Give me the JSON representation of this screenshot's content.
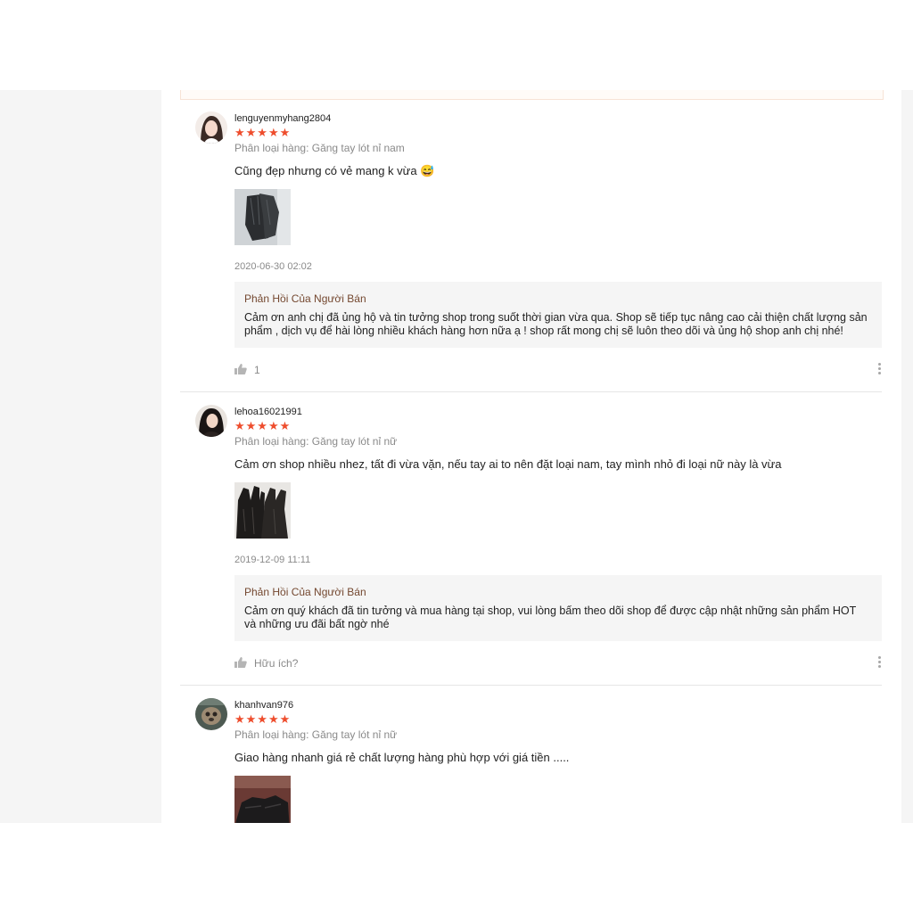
{
  "reviews": [
    {
      "username": "lenguyenmyhang2804",
      "stars": "★★★★★",
      "rating": 5,
      "variant": "Phân loại hàng: Găng tay lót nỉ nam",
      "comment": "Cũng đẹp nhưng có vẻ mang k vừa 😅",
      "date": "2020-06-30 02:02",
      "reply_title": "Phản Hồi Của Người Bán",
      "reply_text": "Cảm ơn anh chị đã ủng hộ và tin tưởng shop trong suốt thời gian vừa qua. Shop sẽ tiếp tục nâng cao cải thiện chất lượng sản phẩm , dịch vụ để hài lòng nhiều khách hàng hơn nữa ạ ! shop  rất mong chị sẽ luôn theo dõi và ủng hộ shop anh chị nhé!",
      "like_label": "1"
    },
    {
      "username": "lehoa16021991",
      "stars": "★★★★★",
      "rating": 5,
      "variant": "Phân loại hàng: Găng tay lót nỉ nữ",
      "comment": "Cảm ơn shop nhiều nhez, tất đi vừa vặn, nếu tay ai to nên đặt loại nam, tay mình nhỏ đi loại nữ này là vừa",
      "date": "2019-12-09 11:11",
      "reply_title": "Phản Hồi Của Người Bán",
      "reply_text": "Cảm ơn quý khách đã tin tưởng và mua hàng tại shop, vui lòng bấm theo dõi shop để được cập nhật những sản phẩm HOT và những ưu đãi bất ngờ nhé",
      "like_label": "Hữu ích?"
    },
    {
      "username": "khanhvan976",
      "stars": "★★★★★",
      "rating": 5,
      "variant": "Phân loại hàng: Găng tay lót nỉ nữ",
      "comment": "Giao hàng nhanh giá rẻ chất lượng hàng phù hợp với giá tiền .....",
      "date": "",
      "reply_title": "",
      "reply_text": "",
      "like_label": ""
    }
  ],
  "colors": {
    "star": "#ee4d2d",
    "reply_title": "#744830",
    "muted": "#8a8a8a",
    "reply_bg": "#f5f5f5"
  },
  "icons": {
    "like": "thumbs-up-icon",
    "more": "more-vertical-icon"
  }
}
